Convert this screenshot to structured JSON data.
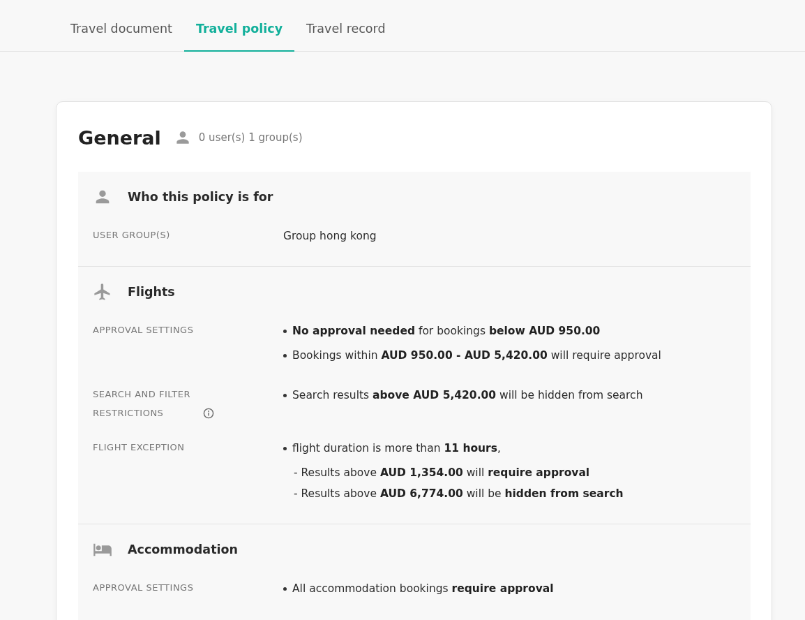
{
  "tabs": [
    {
      "label": "Travel document",
      "selected": false
    },
    {
      "label": "Travel policy",
      "selected": true
    },
    {
      "label": "Travel record",
      "selected": false
    }
  ],
  "policy": {
    "title": "General",
    "assignees": "0 user(s) 1 group(s)",
    "sections": [
      {
        "kind": "person",
        "title": "Who this policy is for",
        "rows": [
          {
            "label": "USER GROUP(S)",
            "info_icon": false,
            "items": [
              {
                "kind": "plain",
                "text": "Group hong kong"
              }
            ]
          }
        ]
      },
      {
        "kind": "plane",
        "title": "Flights",
        "rows": [
          {
            "label": "APPROVAL SETTINGS",
            "info_icon": false,
            "items": [
              {
                "kind": "bullet",
                "text": "**No approval needed** for bookings **below AUD 950.00**"
              },
              {
                "kind": "bullet",
                "text": "Bookings within **AUD 950.00 - AUD 5,420.00** will require approval"
              }
            ]
          },
          {
            "label": "SEARCH AND FILTER RESTRICTIONS",
            "info_icon": true,
            "items": [
              {
                "kind": "bullet",
                "text": "Search results **above AUD 5,420.00** will be hidden from search"
              }
            ]
          },
          {
            "label": "FLIGHT EXCEPTION",
            "info_icon": false,
            "items": [
              {
                "kind": "bullet",
                "text": "flight duration is more than **11 hours**,"
              },
              {
                "kind": "dash",
                "text": "- Results above **AUD 1,354.00** will **require approval**"
              },
              {
                "kind": "dash",
                "text": "- Results above **AUD 6,774.00** will be **hidden from search**"
              }
            ]
          }
        ]
      },
      {
        "kind": "bed",
        "title": "Accommodation",
        "rows": [
          {
            "label": "APPROVAL SETTINGS",
            "info_icon": false,
            "items": [
              {
                "kind": "bullet",
                "text": "All accommodation bookings **require approval**"
              }
            ]
          }
        ]
      }
    ]
  }
}
